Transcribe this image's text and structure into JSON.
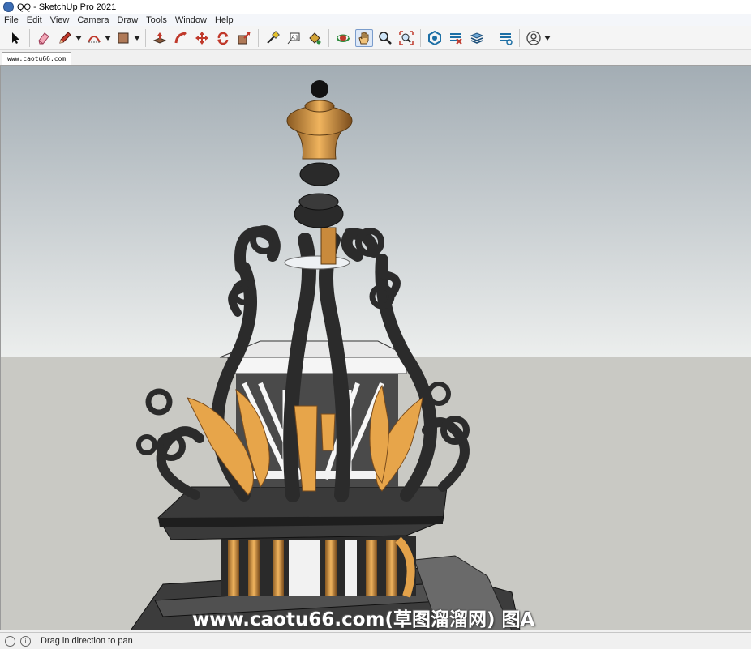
{
  "window": {
    "title": "QQ - SketchUp Pro 2021"
  },
  "menu": [
    {
      "label": "File"
    },
    {
      "label": "Edit"
    },
    {
      "label": "View"
    },
    {
      "label": "Camera"
    },
    {
      "label": "Draw"
    },
    {
      "label": "Tools"
    },
    {
      "label": "Window"
    },
    {
      "label": "Help"
    }
  ],
  "toolbar": {
    "tools": [
      {
        "name": "select-tool"
      },
      {
        "name": "eraser-tool"
      },
      {
        "name": "line-tool"
      },
      {
        "name": "arc-tool"
      },
      {
        "name": "shape-tool"
      },
      {
        "name": "push-pull-tool"
      },
      {
        "name": "follow-me-tool"
      },
      {
        "name": "move-tool"
      },
      {
        "name": "rotate-tool"
      },
      {
        "name": "scale-tool"
      },
      {
        "name": "tape-measure-tool"
      },
      {
        "name": "text-tool"
      },
      {
        "name": "paint-bucket-tool"
      },
      {
        "name": "orbit-tool"
      },
      {
        "name": "pan-tool",
        "active": true
      },
      {
        "name": "zoom-tool"
      },
      {
        "name": "zoom-extents-tool"
      },
      {
        "name": "warehouse-tool"
      },
      {
        "name": "extension-warehouse-tool"
      },
      {
        "name": "layout-tool"
      },
      {
        "name": "extension-manager-tool"
      },
      {
        "name": "account-tool"
      }
    ],
    "text_tool_glyph": "A1"
  },
  "tabs": [
    {
      "label": "www.caotu66.com"
    }
  ],
  "viewport": {
    "watermark": "www.caotu66.com(草图溜溜网) 图A",
    "sky_top": "#a3adb4",
    "sky_bottom": "#eceeed",
    "ground": "#c9c9c4"
  },
  "status": {
    "text": "Drag in direction to pan"
  }
}
